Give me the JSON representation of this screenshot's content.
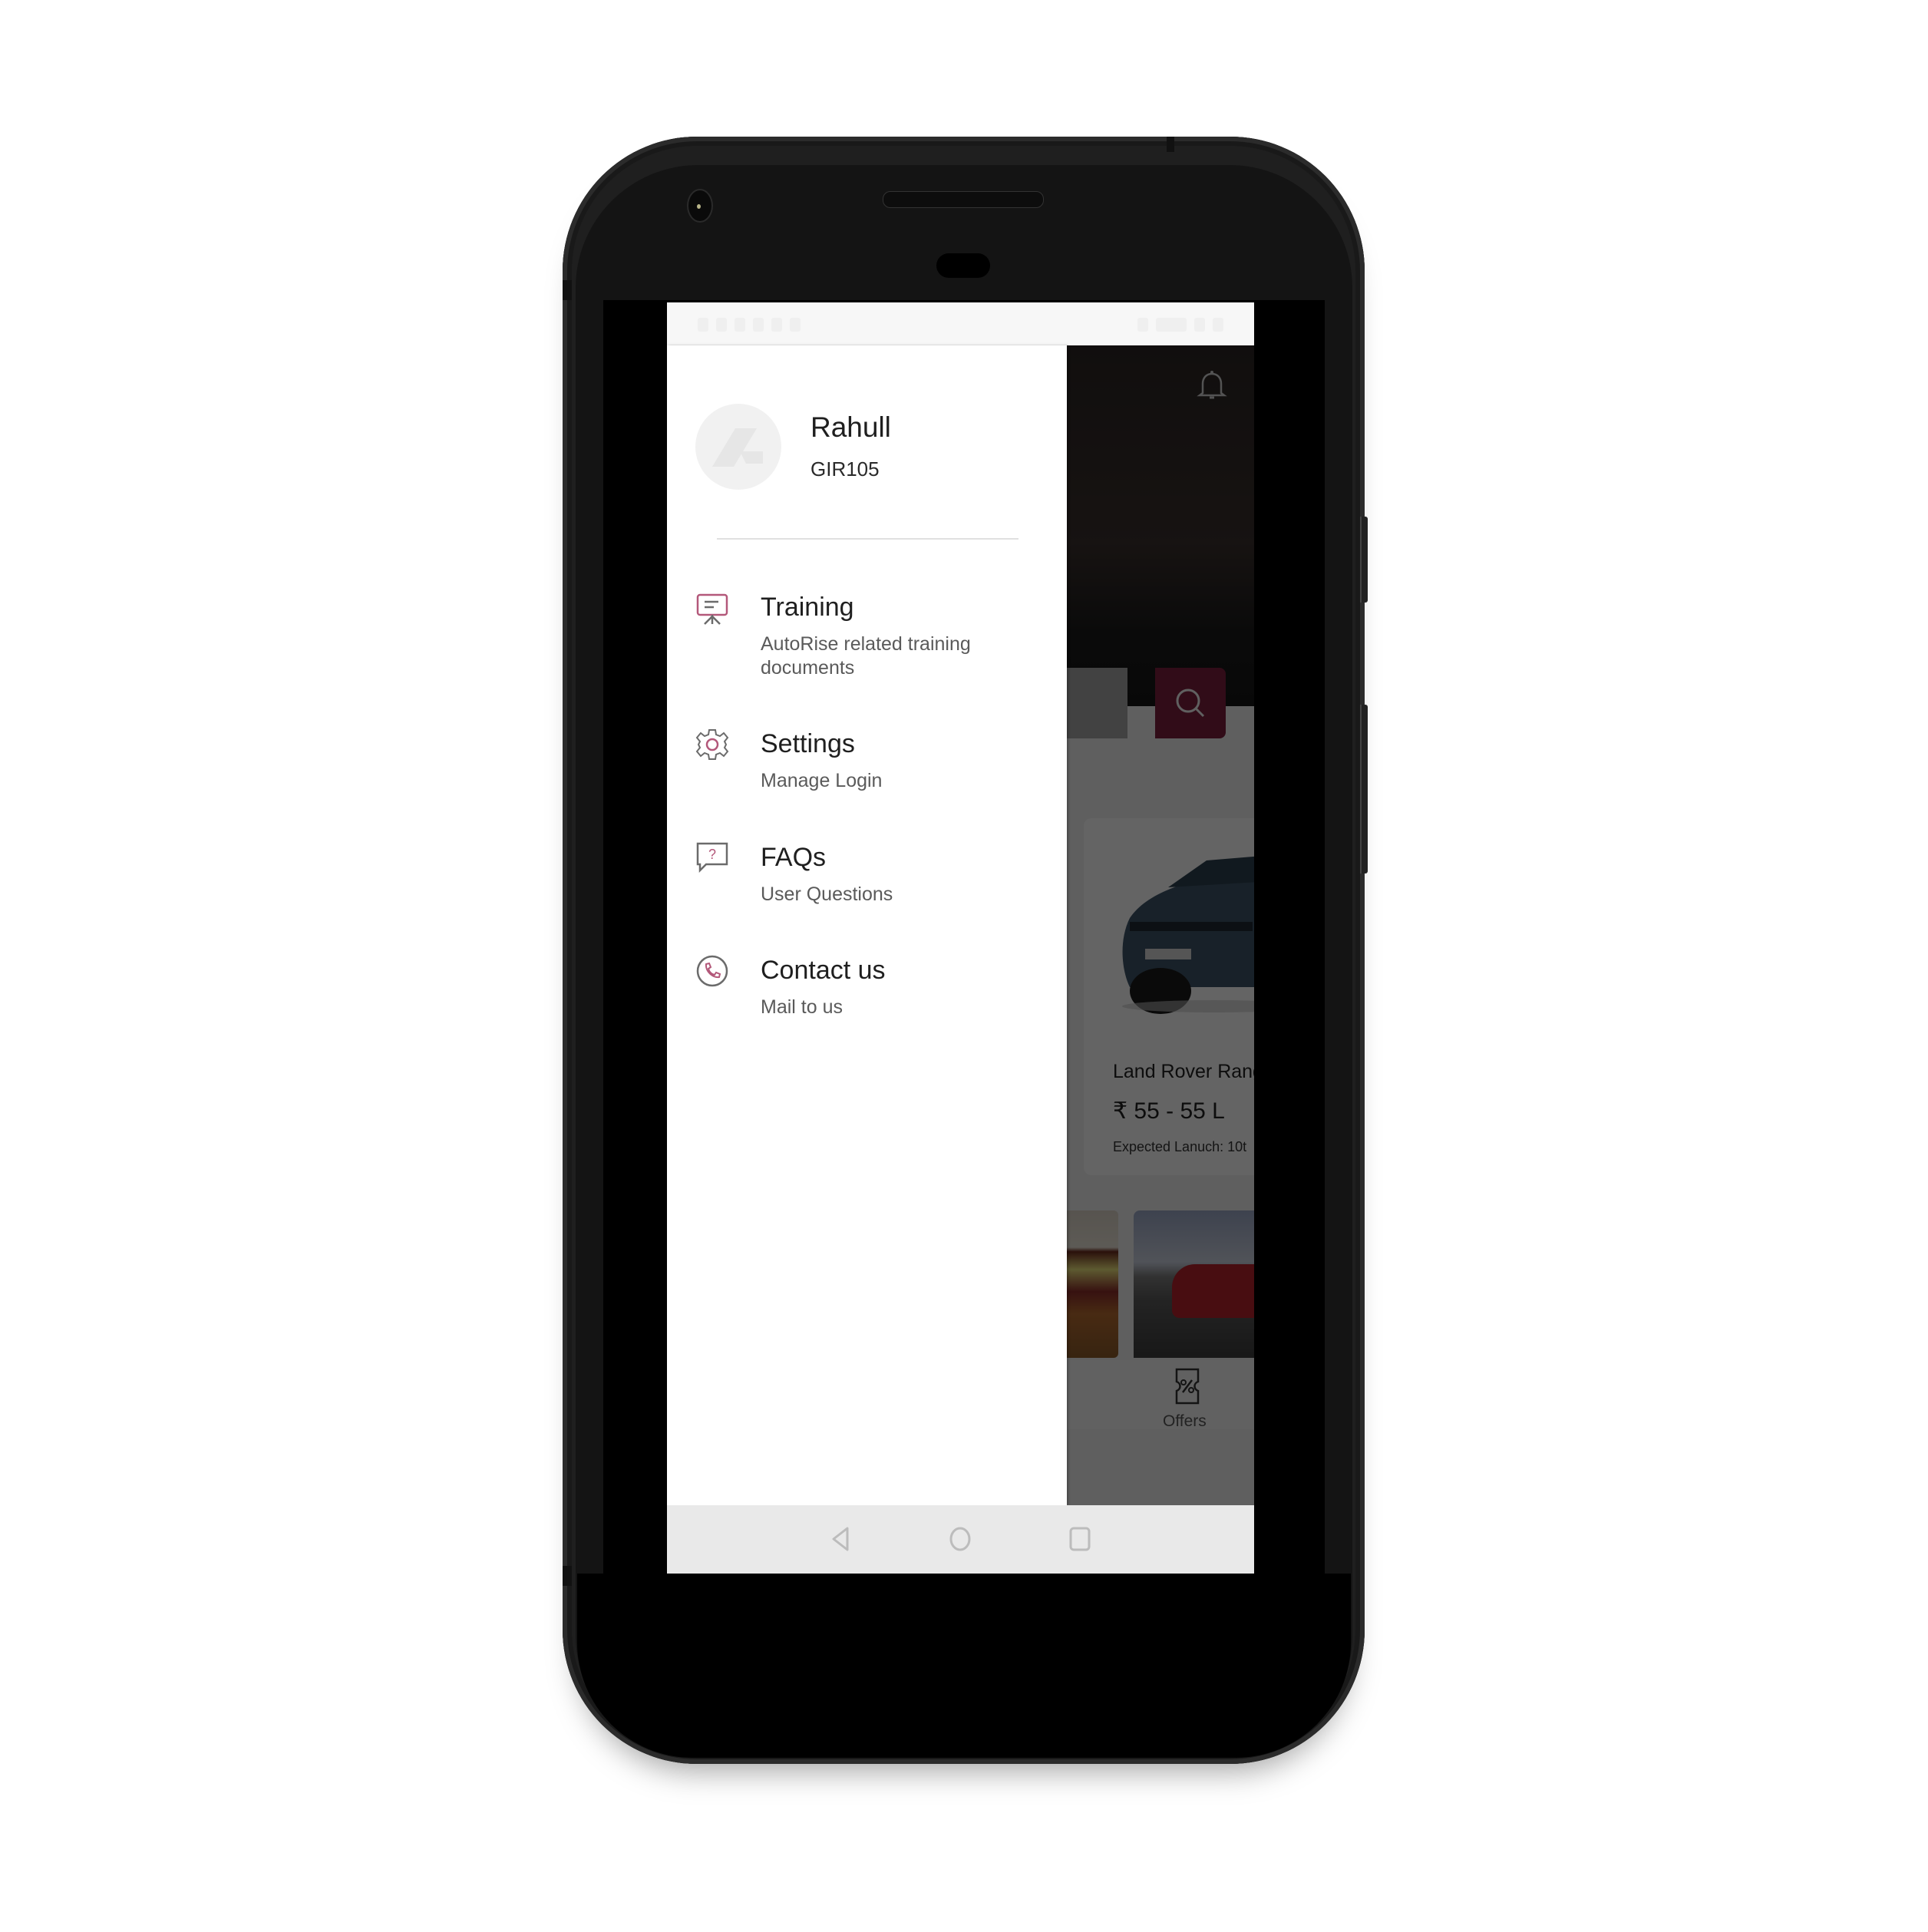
{
  "drawer": {
    "user": {
      "name": "Rahull",
      "id": "GIR105",
      "avatar_icon": "autorise-logo-icon"
    },
    "menu": [
      {
        "title": "Training",
        "subtitle": "AutoRise related training documents",
        "icon": "presentation-board-icon"
      },
      {
        "title": "Settings",
        "subtitle": "Manage Login",
        "icon": "gear-icon"
      },
      {
        "title": "FAQs",
        "subtitle": "User Questions",
        "icon": "question-chat-icon"
      },
      {
        "title": "Contact us",
        "subtitle": "Mail to us",
        "icon": "phone-icon"
      }
    ]
  },
  "background_app": {
    "notification_icon": "bell-icon",
    "search_icon": "search-icon",
    "car_card": {
      "name": "Land Rover Rang",
      "price": "₹ 55 - 55 L",
      "launch": "Expected Lanuch: 10t"
    },
    "bottom_tab": {
      "label": "Offers",
      "icon": "offers-ticket-icon"
    }
  },
  "navbar": {
    "back": "back-icon",
    "home": "home-icon",
    "recents": "recents-icon"
  },
  "colors": {
    "accent": "#7a1f3d",
    "icon_accent": "#b3587a",
    "icon_gray": "#6b6b6b"
  }
}
